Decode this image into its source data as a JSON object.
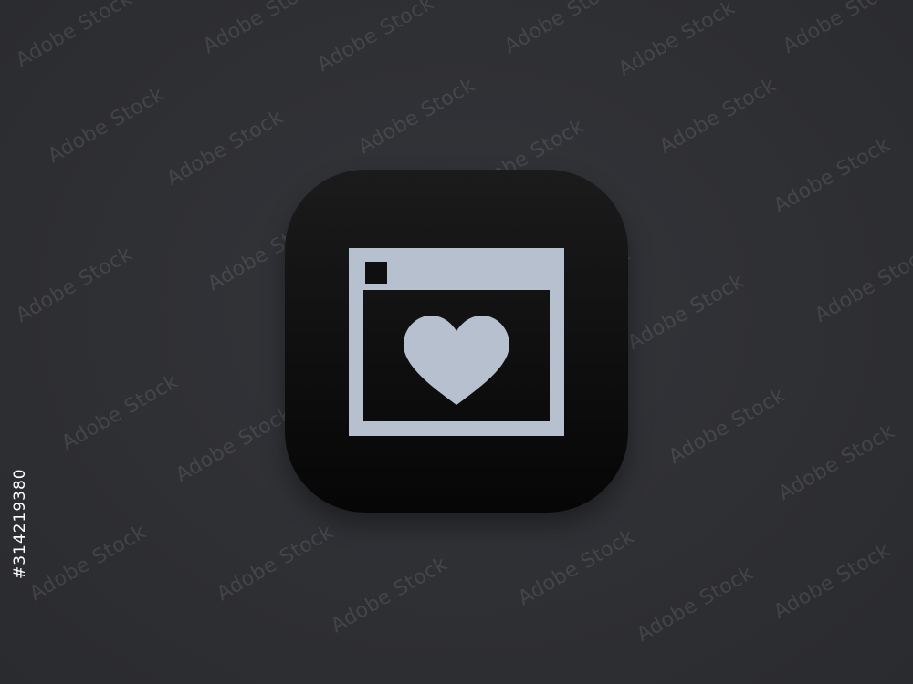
{
  "watermark": {
    "text": "Adobe Stock"
  },
  "stock_id": "#314219380",
  "icon": {
    "name": "browser-heart-icon",
    "fill_color": "#b7c0ce",
    "tile_color": "#0f0f10"
  }
}
